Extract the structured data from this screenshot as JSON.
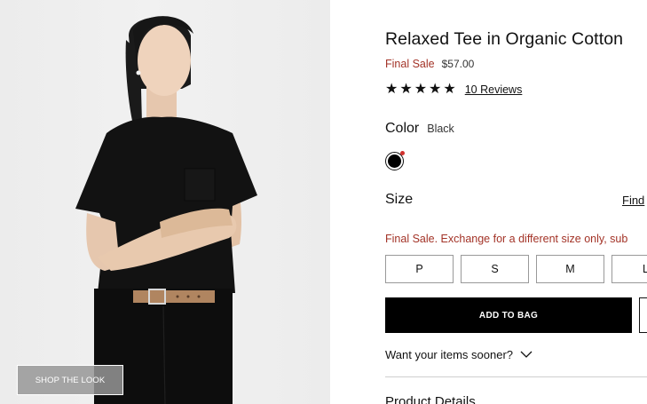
{
  "image": {
    "shop_the_look_label": "SHOP THE LOOK"
  },
  "product": {
    "title": "Relaxed Tee in Organic Cotton",
    "final_sale_label": "Final Sale",
    "price": "$57.00",
    "rating_stars": 5,
    "reviews_label": "10 Reviews"
  },
  "color": {
    "label": "Color",
    "value": "Black",
    "swatch_hex": "#000000"
  },
  "size": {
    "label": "Size",
    "guide_label": "Find",
    "notice": "Final Sale. Exchange for a different size only, sub",
    "options": [
      "P",
      "S",
      "M",
      "L"
    ]
  },
  "actions": {
    "add_to_bag_label": "ADD TO BAG",
    "sooner_label": "Want your items sooner?"
  },
  "sections": {
    "product_details_label": "Product Details"
  },
  "colors": {
    "accent_red": "#a33327",
    "primary_black": "#000000"
  }
}
